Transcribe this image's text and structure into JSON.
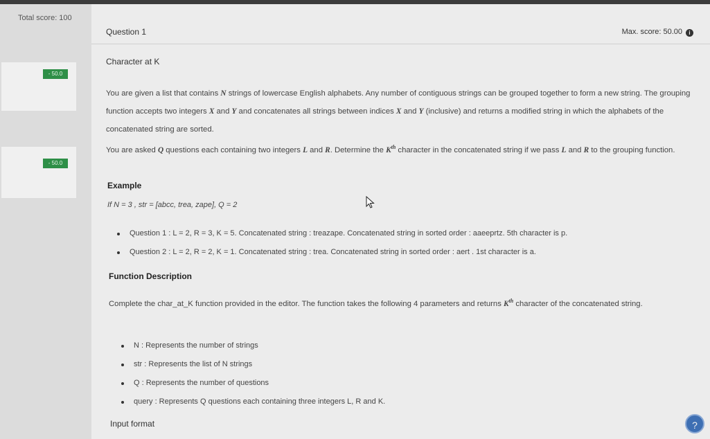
{
  "sidebar": {
    "total_score": "Total score: 100",
    "question_cards": [
      {
        "score": "- 50.0"
      },
      {
        "score": "- 50.0"
      }
    ]
  },
  "question": {
    "number_label": "Question 1",
    "max_score": "Max. score: 50.00",
    "title": "Character at K"
  },
  "description": {
    "p1_a": "You are given a list that contains ",
    "p1_N": "N",
    "p1_b": " strings of lowercase English alphabets. Any number of contiguous strings can be grouped together to form a new string. The grouping function accepts two integers ",
    "p1_X": "X",
    "p1_c": " and ",
    "p1_Y": "Y",
    "p1_d": " and concatenates all strings between indices ",
    "p1_X2": "X",
    "p1_e": " and ",
    "p1_Y2": "Y",
    "p1_f": " (inclusive) and returns a modified string in which the alphabets of the concatenated string are sorted.",
    "p2_a": "You are asked ",
    "p2_Q": "Q",
    "p2_b": " questions each containing two integers ",
    "p2_L": "L",
    "p2_c": " and ",
    "p2_R": "R",
    "p2_d": ". Determine the ",
    "p2_K": "K",
    "p2_th": "th",
    "p2_e": " character in the concatenated string if we pass ",
    "p2_L2": "L",
    "p2_f": " and ",
    "p2_R2": "R",
    "p2_g": " to the grouping function."
  },
  "example": {
    "heading": "Example",
    "line": "If N = 3 , str = [abcc, trea, zape], Q = 2",
    "items": [
      "Question 1 : L = 2, R = 3, K = 5. Concatenated string : treazape. Concatenated string in sorted order : aaeeprtz. 5th character is p.",
      "Question 2 : L = 2, R = 2, K = 1. Concatenated string : trea. Concatenated string in sorted order : aert . 1st character is a."
    ]
  },
  "function_description": {
    "heading": "Function Description",
    "text_a": "Complete the char_at_K function provided in the editor. The function takes the following 4 parameters and returns ",
    "text_K": "K",
    "text_th": "th",
    "text_b": " character of the concatenated string.",
    "params": [
      "N : Represents the number of strings",
      "str : Represents the list of N strings",
      "Q : Represents the number of questions",
      "query : Represents Q questions each containing three integers L, R and K."
    ]
  },
  "input_format": {
    "heading": "Input format"
  },
  "help": {
    "symbol": "?"
  }
}
